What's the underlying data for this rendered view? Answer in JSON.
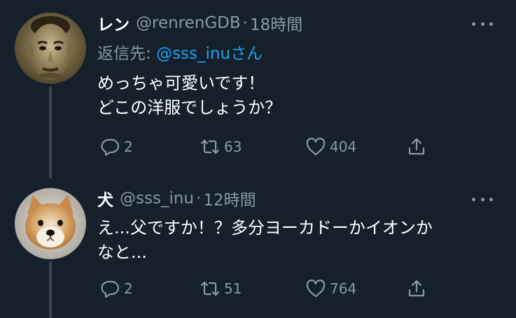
{
  "tweets": [
    {
      "display_name": "レン",
      "handle": "@renrenGDB",
      "separator": "·",
      "time": "18時間",
      "reply_to_prefix": "返信先: ",
      "reply_to_mention": "@sss_inu",
      "reply_to_suffix": "さん",
      "body_lines": [
        "めっちゃ可愛いです！",
        "どこの洋服でしょうか？"
      ],
      "reply_count": "2",
      "retweet_count": "63",
      "like_count": "404",
      "avatar_icon": "face-illustration-avatar"
    },
    {
      "display_name": "犬",
      "handle": "@sss_inu",
      "separator": "·",
      "time": "12時間",
      "body_lines": [
        "え...父ですか！？多分ヨーカドーかイオンか",
        "なと..."
      ],
      "reply_count": "2",
      "retweet_count": "51",
      "like_count": "764",
      "avatar_icon": "shiba-dog-avatar"
    }
  ],
  "colors": {
    "background": "#15202b",
    "text": "#ffffff",
    "secondary_text": "#8899a6",
    "mention": "#1da1f2",
    "thread_line": "#38444d"
  },
  "icons": [
    "more-options-icon",
    "reply-icon",
    "retweet-icon",
    "like-icon",
    "share-icon"
  ]
}
